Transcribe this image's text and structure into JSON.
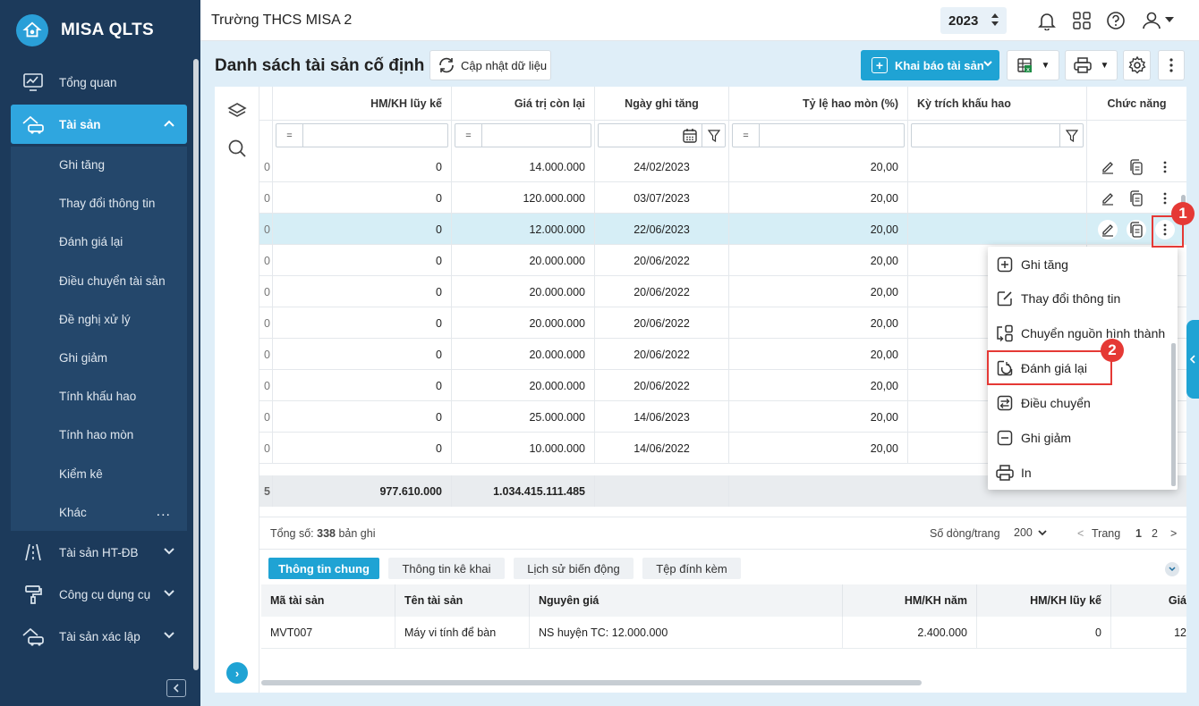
{
  "app": {
    "name": "MISA QLTS"
  },
  "sidebar": {
    "items": [
      {
        "label": "Tổng quan",
        "icon": "dashboard-icon"
      },
      {
        "label": "Tài sản",
        "icon": "car-house-icon",
        "expanded": true
      },
      {
        "label": "Tài sản HT-ĐB",
        "icon": "road-icon"
      },
      {
        "label": "Công cụ dụng cụ",
        "icon": "paint-roller-icon"
      },
      {
        "label": "Tài sản xác lập",
        "icon": "car-house-icon"
      }
    ],
    "submenu": [
      "Ghi tăng",
      "Thay đổi thông tin",
      "Đánh giá lại",
      "Điều chuyển tài sản",
      "Đề nghị xử lý",
      "Ghi giảm",
      "Tính khấu hao",
      "Tính hao mòn",
      "Kiểm kê",
      "Khác"
    ],
    "more_label": "..."
  },
  "header": {
    "org": "Trường THCS MISA 2",
    "year": "2023"
  },
  "toolbar": {
    "title": "Danh sách tài sản cố định",
    "refresh_label": "Cập nhật dữ liệu",
    "add_label": "Khai báo tài sản"
  },
  "grid": {
    "columns": [
      "HM/KH lũy kế",
      "Giá trị còn lại",
      "Ngày ghi tăng",
      "Tỷ lệ hao mòn (%)",
      "Kỳ trích khấu hao",
      "Chức năng"
    ],
    "filter_eq": "=",
    "rows": [
      {
        "lead": "0",
        "hmkh": "0",
        "gtcl": "14.000.000",
        "date": "24/02/2023",
        "rate": "20,00"
      },
      {
        "lead": "0",
        "hmkh": "0",
        "gtcl": "120.000.000",
        "date": "03/07/2023",
        "rate": "20,00"
      },
      {
        "lead": "0",
        "hmkh": "0",
        "gtcl": "12.000.000",
        "date": "22/06/2023",
        "rate": "20,00",
        "selected": true
      },
      {
        "lead": "0",
        "hmkh": "0",
        "gtcl": "20.000.000",
        "date": "20/06/2022",
        "rate": "20,00"
      },
      {
        "lead": "0",
        "hmkh": "0",
        "gtcl": "20.000.000",
        "date": "20/06/2022",
        "rate": "20,00"
      },
      {
        "lead": "0",
        "hmkh": "0",
        "gtcl": "20.000.000",
        "date": "20/06/2022",
        "rate": "20,00"
      },
      {
        "lead": "0",
        "hmkh": "0",
        "gtcl": "20.000.000",
        "date": "20/06/2022",
        "rate": "20,00"
      },
      {
        "lead": "0",
        "hmkh": "0",
        "gtcl": "20.000.000",
        "date": "20/06/2022",
        "rate": "20,00"
      },
      {
        "lead": "0",
        "hmkh": "0",
        "gtcl": "25.000.000",
        "date": "14/06/2023",
        "rate": "20,00"
      },
      {
        "lead": "0",
        "hmkh": "0",
        "gtcl": "10.000.000",
        "date": "14/06/2022",
        "rate": "20,00"
      }
    ],
    "totals": {
      "lead": "5",
      "hmkh": "977.610.000",
      "gtcl": "1.034.415.111.485"
    }
  },
  "pager": {
    "total_prefix": "Tổng số:",
    "total_count": "338",
    "total_suffix": "bản ghi",
    "rows_label": "Số dòng/trang",
    "rows_value": "200",
    "prev": "<",
    "page_label": "Trang",
    "page_1": "1",
    "page_2": "2",
    "next": ">"
  },
  "detail": {
    "tabs": [
      "Thông tin chung",
      "Thông tin kê khai",
      "Lịch sử biến động",
      "Tệp đính kèm"
    ],
    "columns": [
      "Mã tài sản",
      "Tên tài sản",
      "Nguyên giá",
      "HM/KH năm",
      "HM/KH lũy kế",
      "Giá"
    ],
    "row": [
      "MVT007",
      "Máy vi tính để bàn",
      "NS huyện TC: 12.000.000",
      "2.400.000",
      "0",
      "12"
    ]
  },
  "context_menu": {
    "items": [
      {
        "label": "Ghi tăng",
        "icon": "plus-square-icon"
      },
      {
        "label": "Thay đổi thông tin",
        "icon": "edit-square-icon"
      },
      {
        "label": "Chuyển nguồn hình thành",
        "icon": "transfer-source-icon"
      },
      {
        "label": "Đánh giá lại",
        "icon": "reevaluate-icon"
      },
      {
        "label": "Điều chuyển",
        "icon": "transfer-icon"
      },
      {
        "label": "Ghi giảm",
        "icon": "minus-square-icon"
      },
      {
        "label": "In",
        "icon": "printer-icon"
      }
    ]
  },
  "callouts": {
    "one": "1",
    "two": "2"
  },
  "colors": {
    "sidebar": "#1c3a5b",
    "accent": "#1fa3d4",
    "callout": "#e53935",
    "content_bg": "#dfeef8"
  }
}
